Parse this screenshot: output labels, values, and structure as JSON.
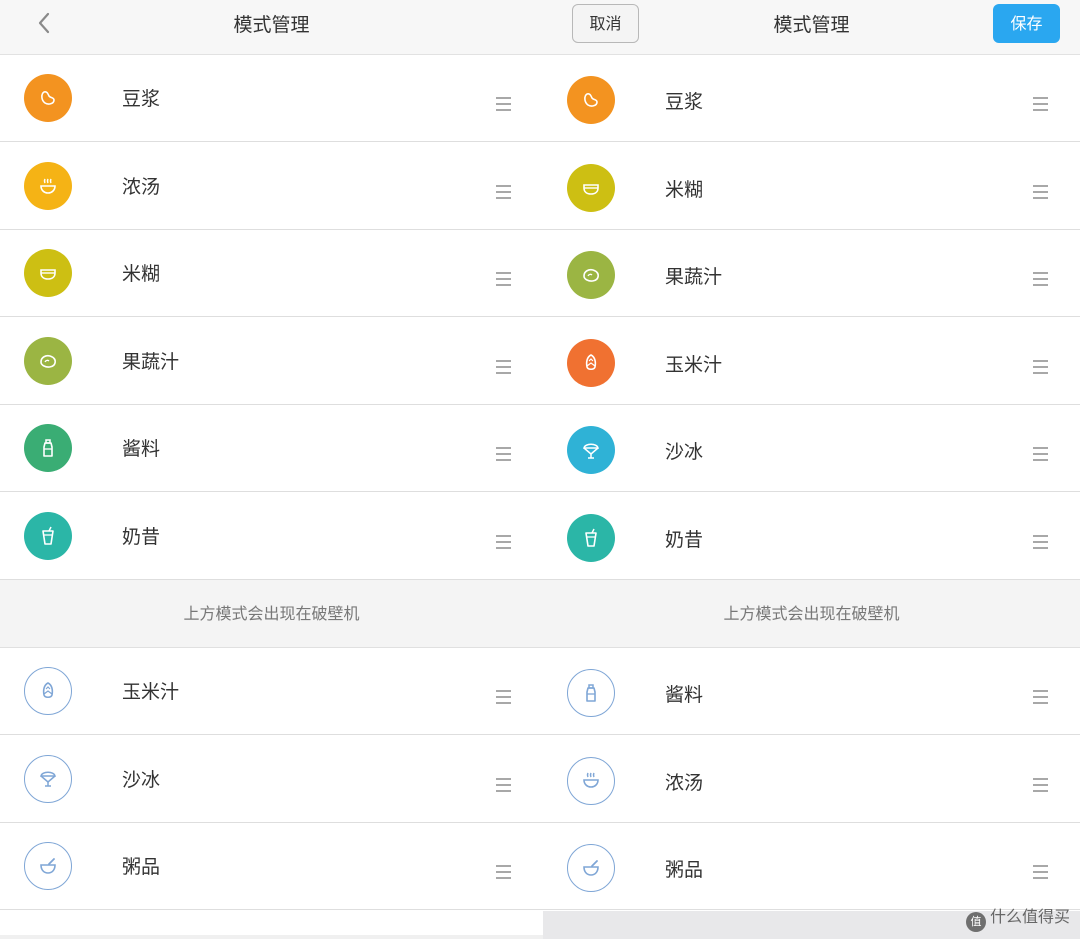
{
  "left": {
    "header": {
      "title": "模式管理"
    },
    "active_modes": [
      {
        "label": "豆浆",
        "icon": "bean-icon",
        "color": "#f39320"
      },
      {
        "label": "浓汤",
        "icon": "soup-bowl-icon",
        "color": "#f5b315"
      },
      {
        "label": "米糊",
        "icon": "rice-bowl-icon",
        "color": "#cdbf13"
      },
      {
        "label": "果蔬汁",
        "icon": "lemon-icon",
        "color": "#9bb543"
      },
      {
        "label": "酱料",
        "icon": "sauce-bottle-icon",
        "color": "#3aad74"
      },
      {
        "label": "奶昔",
        "icon": "milkshake-cup-icon",
        "color": "#2bb6a7"
      }
    ],
    "divider_text": "上方模式会出现在破壁机",
    "inactive_modes": [
      {
        "label": "玉米汁",
        "icon": "corn-icon"
      },
      {
        "label": "沙冰",
        "icon": "ice-cream-icon"
      },
      {
        "label": "粥品",
        "icon": "porridge-bowl-icon"
      }
    ]
  },
  "right": {
    "header": {
      "title": "模式管理",
      "cancel_label": "取消",
      "save_label": "保存"
    },
    "active_modes": [
      {
        "label": "豆浆",
        "icon": "bean-icon",
        "color": "#f39320"
      },
      {
        "label": "米糊",
        "icon": "rice-bowl-icon",
        "color": "#cdbf13"
      },
      {
        "label": "果蔬汁",
        "icon": "lemon-icon",
        "color": "#9bb543"
      },
      {
        "label": "玉米汁",
        "icon": "corn-icon",
        "color": "#f07131"
      },
      {
        "label": "沙冰",
        "icon": "ice-cream-icon",
        "color": "#2fb2d6"
      },
      {
        "label": "奶昔",
        "icon": "milkshake-cup-icon",
        "color": "#2bb6a7"
      }
    ],
    "divider_text": "上方模式会出现在破壁机",
    "inactive_modes": [
      {
        "label": "酱料",
        "icon": "sauce-bottle-icon"
      },
      {
        "label": "浓汤",
        "icon": "soup-bowl-icon"
      },
      {
        "label": "粥品",
        "icon": "porridge-bowl-icon"
      }
    ]
  },
  "watermark": {
    "logo_text": "值",
    "text": "什么值得买"
  },
  "colors": {
    "accent": "#2aa7f0",
    "outline_icon": "#7fa6d6"
  }
}
